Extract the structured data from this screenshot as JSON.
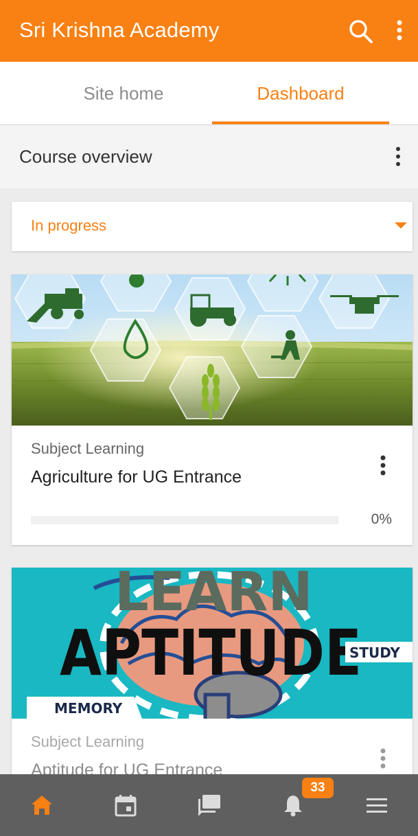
{
  "app": {
    "title": "Sri Krishna Academy",
    "accent_color": "#f98012",
    "icons": {
      "search": "search-icon",
      "menu": "more-vert-icon"
    }
  },
  "tabs": [
    {
      "label": "Site home",
      "active": false
    },
    {
      "label": "Dashboard",
      "active": true
    }
  ],
  "overview": {
    "title": "Course overview",
    "menu_icon": "more-vert-icon"
  },
  "filter": {
    "selected": "In progress",
    "icon": "dropdown-arrow-icon"
  },
  "courses": [
    {
      "category": "Subject Learning",
      "name": "Agriculture for UG Entrance",
      "progress_percent": 0,
      "progress_label": "0%",
      "image": "agriculture-field-banner"
    },
    {
      "category": "Subject Learning",
      "name": "Aptitude for UG Entrance",
      "image": "aptitude-brain-banner",
      "image_text": {
        "learn": "LEARN",
        "aptitude": "APTITUDE",
        "study": "STUDY",
        "memory": "MEMORY"
      }
    }
  ],
  "bottom_nav": {
    "items": [
      {
        "icon": "home-icon",
        "active": true
      },
      {
        "icon": "calendar-icon",
        "active": false
      },
      {
        "icon": "messages-icon",
        "active": false
      },
      {
        "icon": "notifications-icon",
        "active": false
      },
      {
        "icon": "hamburger-menu-icon",
        "active": false
      }
    ],
    "notification_badge": "33"
  }
}
